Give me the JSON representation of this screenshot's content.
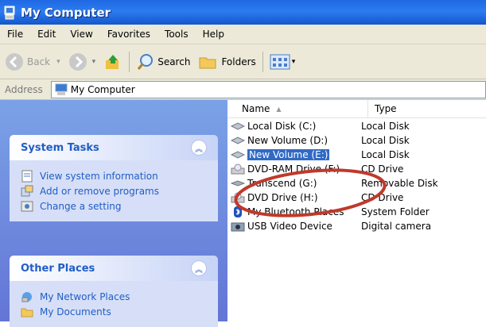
{
  "window": {
    "title": "My Computer"
  },
  "menu": [
    "File",
    "Edit",
    "View",
    "Favorites",
    "Tools",
    "Help"
  ],
  "toolbar": {
    "back": "Back",
    "search": "Search",
    "folders": "Folders"
  },
  "address": {
    "label": "Address",
    "value": "My Computer"
  },
  "system_tasks": {
    "title": "System Tasks",
    "items": [
      "View system information",
      "Add or remove programs",
      "Change a setting"
    ]
  },
  "other_places": {
    "title": "Other Places",
    "items": [
      "My Network Places",
      "My Documents"
    ]
  },
  "columns": {
    "name": "Name",
    "type": "Type"
  },
  "rows": [
    {
      "name": "Local Disk (C:)",
      "type": "Local Disk",
      "icon": "hard-drive-icon"
    },
    {
      "name": "New Volume (D:)",
      "type": "Local Disk",
      "icon": "hard-drive-icon"
    },
    {
      "name": "New Volume (E:)",
      "type": "Local Disk",
      "icon": "hard-drive-icon",
      "selected": true
    },
    {
      "name": "DVD-RAM Drive (F:)",
      "type": "CD Drive",
      "icon": "cd-drive-icon"
    },
    {
      "name": "Transcend (G:)",
      "type": "Removable Disk",
      "icon": "removable-drive-icon"
    },
    {
      "name": "DVD Drive (H:)",
      "type": "CD Drive",
      "icon": "cd-drive-icon"
    },
    {
      "name": "My Bluetooth Places",
      "type": "System Folder",
      "icon": "bluetooth-icon"
    },
    {
      "name": "USB Video Device",
      "type": "Digital camera",
      "icon": "camera-icon"
    }
  ],
  "colors": {
    "title_bar": "#2c7cf0",
    "selection": "#316ac5",
    "annotation": "#c0392b",
    "task_link": "#215dc6"
  }
}
